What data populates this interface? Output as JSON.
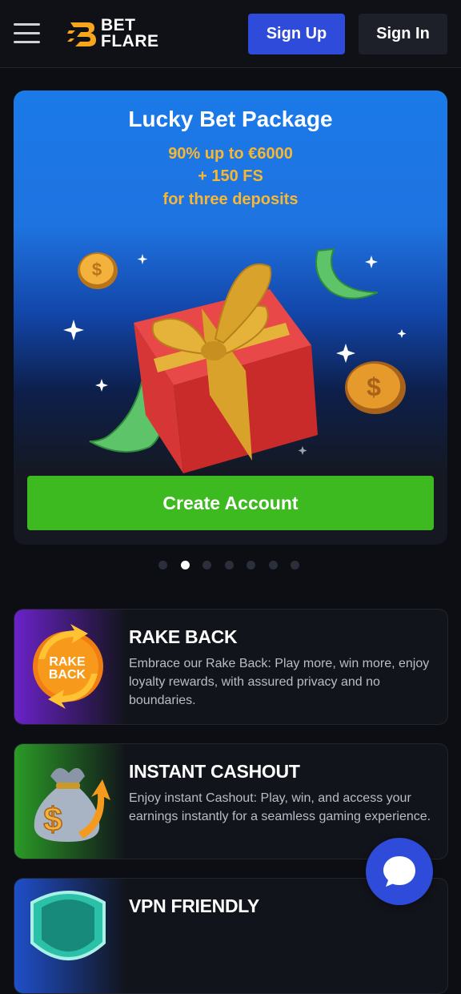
{
  "header": {
    "logo_line1": "BET",
    "logo_line2": "FLARE",
    "signup_label": "Sign Up",
    "signin_label": "Sign In"
  },
  "promo": {
    "title": "Lucky Bet Package",
    "line1": "90% up to €6000",
    "line2": "+ 150 FS",
    "line3": "for three deposits",
    "cta_label": "Create Account"
  },
  "carousel": {
    "total": 7,
    "active_index": 1
  },
  "features": [
    {
      "title": "RAKE BACK",
      "badge_line1": "RAKE",
      "badge_line2": "BACK",
      "description": "Embrace our Rake Back: Play more, win more, enjoy loyalty rewards, with assured privacy and no boundaries."
    },
    {
      "title": "INSTANT CASHOUT",
      "description": "Enjoy instant Cashout: Play, win, and access your earnings instantly for a seamless gaming experience."
    },
    {
      "title": "VPN FRIENDLY",
      "description": ""
    }
  ],
  "colors": {
    "brand_blue": "#2f4bd9",
    "cta_green": "#3dba1f",
    "promo_accent": "#f7b733",
    "logo_orange": "#f7a61c"
  }
}
